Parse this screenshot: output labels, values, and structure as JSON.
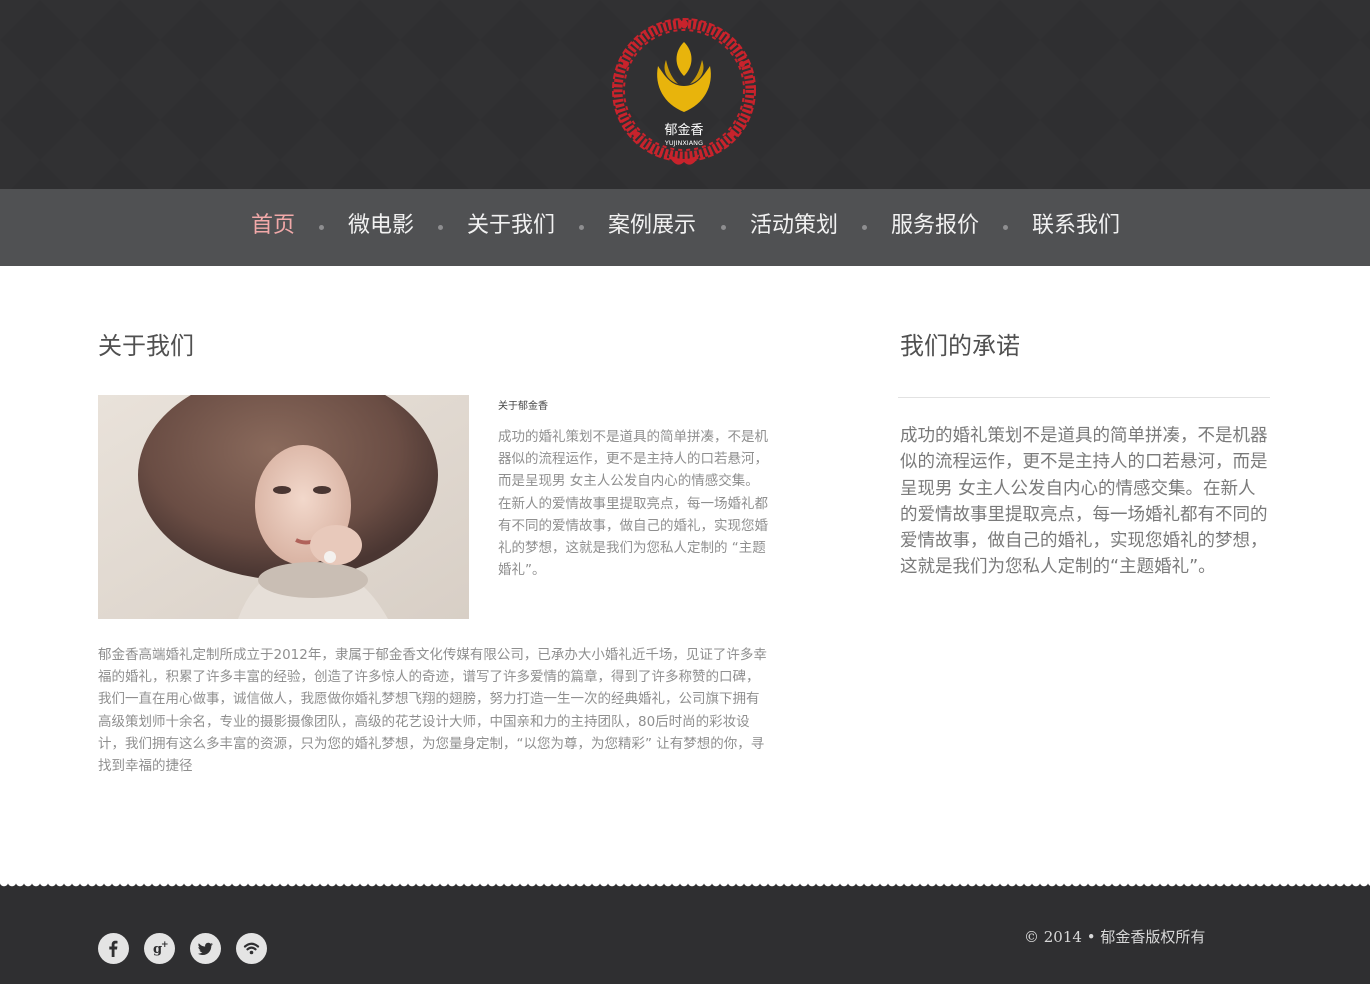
{
  "logo": {
    "brand_cn": "郁金香",
    "brand_en": "YUJINXIANG",
    "ring_color": "#c8232c",
    "tulip_color": "#e8b40c"
  },
  "nav": {
    "items": [
      {
        "label": "首页",
        "active": true
      },
      {
        "label": "微电影",
        "active": false
      },
      {
        "label": "关于我们",
        "active": false
      },
      {
        "label": "案例展示",
        "active": false
      },
      {
        "label": "活动策划",
        "active": false
      },
      {
        "label": "服务报价",
        "active": false
      },
      {
        "label": "联系我们",
        "active": false
      }
    ]
  },
  "about": {
    "title": "关于我们",
    "subtitle": "关于郁金香",
    "intro": "成功的婚礼策划不是道具的简单拼凑，不是机器似的流程运作，更不是主持人的口若悬河，而是呈现男 女主人公发自内心的情感交集。在新人的爱情故事里提取亮点，每一场婚礼都有不同的爱情故事，做自己的婚礼，实现您婚礼的梦想，这就是我们为您私人定制的 “主题婚礼”。",
    "body": "郁金香高端婚礼定制所成立于2012年，隶属于郁金香文化传媒有限公司，已承办大小婚礼近千场，见证了许多幸福的婚礼，积累了许多丰富的经验，创造了许多惊人的奇迹，谱写了许多爱情的篇章，得到了许多称赞的口碑，我们一直在用心做事，诚信做人，我愿做你婚礼梦想飞翔的翅膀，努力打造一生一次的经典婚礼，公司旗下拥有高级策划师十余名，专业的摄影摄像团队，高级的花艺设计大师，中国亲和力的主持团队，80后时尚的彩妆设计，我们拥有这么多丰富的资源，只为您的婚礼梦想，为您量身定制，“以您为尊，为您精彩” 让有梦想的你，寻找到幸福的捷径"
  },
  "promise": {
    "title": "我们的承诺",
    "text": "成功的婚礼策划不是道具的简单拼凑，不是机器似的流程运作，更不是主持人的口若悬河，而是呈现男 女主人公发自内心的情感交集。在新人的爱情故事里提取亮点，每一场婚礼都有不同的爱情故事，做自己的婚礼，实现您婚礼的梦想，这就是我们为您私人定制的“主题婚礼”。"
  },
  "footer": {
    "social_icons": [
      "facebook-icon",
      "google-plus-icon",
      "twitter-icon",
      "rss-icon"
    ],
    "copyright": "© 2014 • 郁金香版权所有"
  }
}
